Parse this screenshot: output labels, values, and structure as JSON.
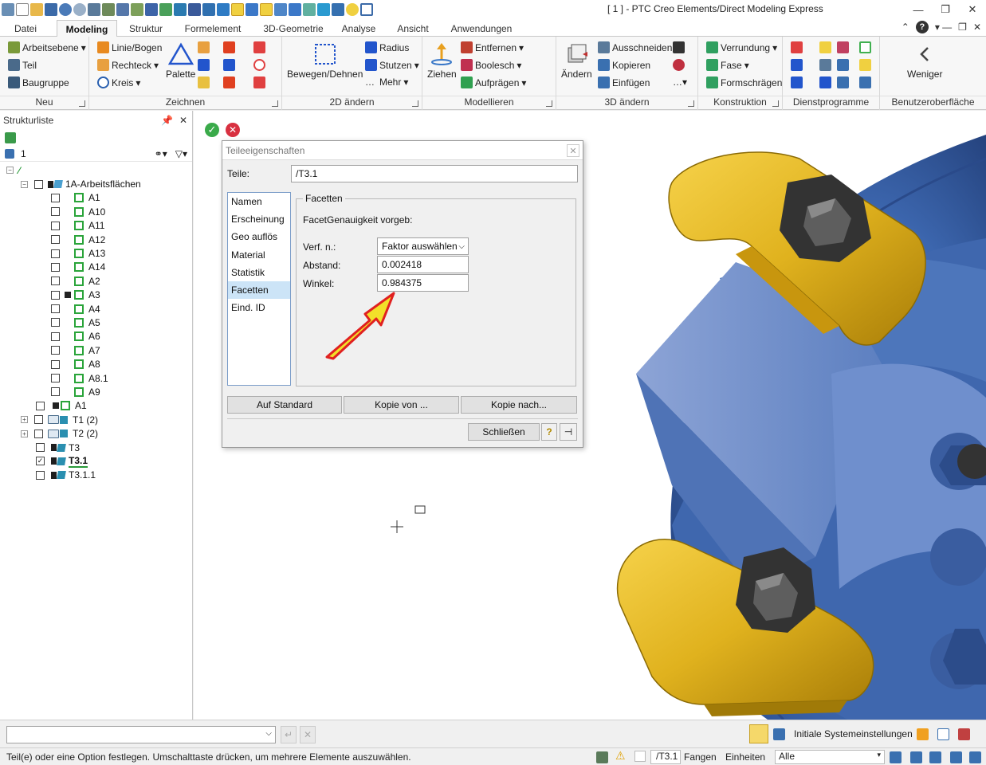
{
  "window": {
    "title": "[ 1 ] - PTC Creo Elements/Direct Modeling Express",
    "controls": [
      "minimize-icon",
      "restore-icon",
      "close-icon"
    ]
  },
  "ribbon_tabs": [
    {
      "label": "Datei",
      "active": false
    },
    {
      "label": "Modeling",
      "active": true
    },
    {
      "label": "Struktur",
      "active": false
    },
    {
      "label": "Formelement",
      "active": false
    },
    {
      "label": "3D-Geometrie",
      "active": false
    },
    {
      "label": "Analyse",
      "active": false
    },
    {
      "label": "Ansicht",
      "active": false
    },
    {
      "label": "Anwendungen",
      "active": false
    }
  ],
  "ribbon": {
    "neu": {
      "label": "Neu",
      "items": [
        "Arbeitsebene",
        "Teil",
        "Baugruppe"
      ]
    },
    "zeichnen": {
      "label": "Zeichnen",
      "items": [
        "Linie/Bogen",
        "Rechteck",
        "Kreis"
      ],
      "palette": "Palette"
    },
    "aendern2d": {
      "label": "2D ändern",
      "big": "Bewegen/Dehnen",
      "items": [
        "Radius",
        "Stutzen",
        "Mehr"
      ]
    },
    "modellieren": {
      "label": "Modellieren",
      "big": "Ziehen",
      "items": [
        "Entfernen",
        "Boolesch",
        "Aufprägen"
      ]
    },
    "aendern3d": {
      "label": "3D ändern",
      "big": "Ändern",
      "items": [
        "Ausschneiden",
        "Kopieren",
        "Einfügen"
      ]
    },
    "konstruktion": {
      "label": "Konstruktion",
      "items": [
        "Verrundung",
        "Fase",
        "Formschrägen"
      ]
    },
    "dienstprogramme": {
      "label": "Dienstprogramme"
    },
    "benutzeroberflaeche": {
      "label": "Benutzeroberfläche",
      "big": "Weniger"
    }
  },
  "structure_panel": {
    "title": "Strukturliste",
    "current": "1",
    "tree": [
      {
        "label": "1A-Arbeitsflächen",
        "level": 1,
        "type": "assembly",
        "expander": "-"
      },
      {
        "label": "A1",
        "level": 2,
        "type": "wp"
      },
      {
        "label": "A10",
        "level": 2,
        "type": "wp"
      },
      {
        "label": "A11",
        "level": 2,
        "type": "wp"
      },
      {
        "label": "A12",
        "level": 2,
        "type": "wp"
      },
      {
        "label": "A13",
        "level": 2,
        "type": "wp"
      },
      {
        "label": "A14",
        "level": 2,
        "type": "wp"
      },
      {
        "label": "A2",
        "level": 2,
        "type": "wp"
      },
      {
        "label": "A3",
        "level": 2,
        "type": "wp-lock"
      },
      {
        "label": "A4",
        "level": 2,
        "type": "wp"
      },
      {
        "label": "A5",
        "level": 2,
        "type": "wp"
      },
      {
        "label": "A6",
        "level": 2,
        "type": "wp"
      },
      {
        "label": "A7",
        "level": 2,
        "type": "wp"
      },
      {
        "label": "A8",
        "level": 2,
        "type": "wp"
      },
      {
        "label": "A8.1",
        "level": 2,
        "type": "wp"
      },
      {
        "label": "A9",
        "level": 2,
        "type": "wp"
      },
      {
        "label": "A1",
        "level": 1,
        "type": "wp-lock"
      },
      {
        "label": "T1 (2)",
        "level": 1,
        "type": "folder",
        "expander": "+"
      },
      {
        "label": "T2 (2)",
        "level": 1,
        "type": "folder",
        "expander": "+"
      },
      {
        "label": "T3",
        "level": 1,
        "type": "part"
      },
      {
        "label": "T3.1",
        "level": 1,
        "type": "part",
        "checked": true,
        "bold": true
      },
      {
        "label": "T3.1.1",
        "level": 1,
        "type": "part"
      }
    ]
  },
  "dialog": {
    "title": "Teileeigenschaften",
    "teile_label": "Teile:",
    "teile_value": "/T3.1",
    "nav": [
      "Namen",
      "Erscheinung",
      "Geo auflös",
      "Material",
      "Statistik",
      "Facetten",
      "Eind. ID"
    ],
    "nav_selected": "Facetten",
    "group_title": "Facetten",
    "subtitle": "FacetGenauigkeit vorgeb:",
    "verf_label": "Verf. n.:",
    "verf_value": "Faktor auswählen",
    "abstand_label": "Abstand:",
    "abstand_value": "0.002418",
    "winkel_label": "Winkel:",
    "winkel_value": "0.984375",
    "btn_standard": "Auf Standard",
    "btn_kopie_von": "Kopie von ...",
    "btn_kopie_nach": "Kopie nach...",
    "btn_close": "Schließen"
  },
  "bottom": {
    "systemsettings": "Initiale Systemeinstellungen"
  },
  "status": {
    "message": "Teil(e) oder eine Option festlegen. Umschalttaste drücken, um mehrere Elemente auszuwählen.",
    "part": "/T3.1",
    "fangen": "Fangen",
    "einheiten": "Einheiten",
    "filter": "Alle"
  }
}
